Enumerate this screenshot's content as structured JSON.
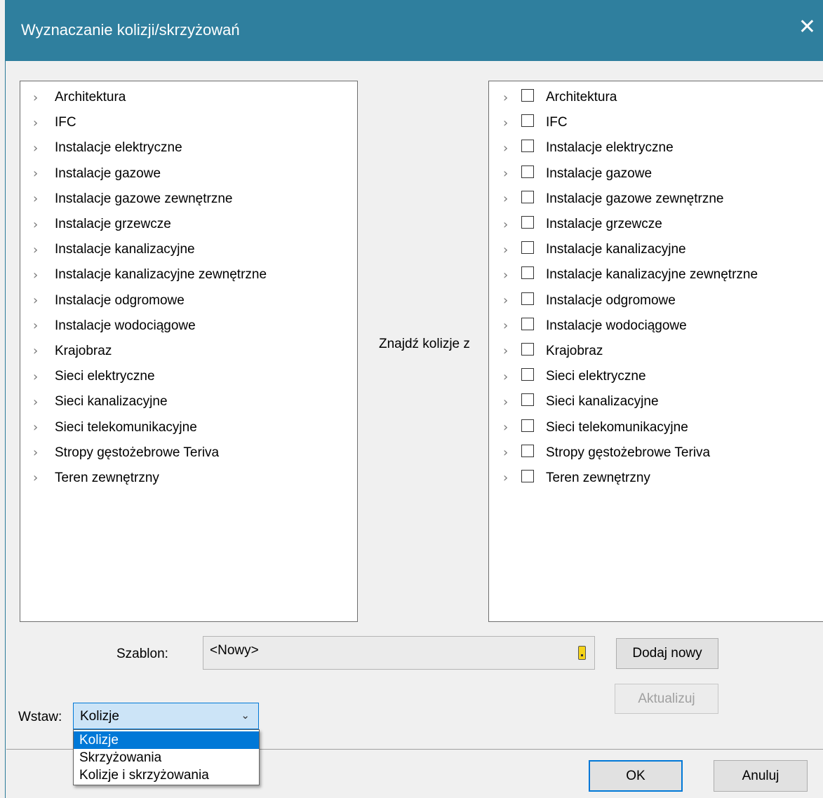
{
  "window": {
    "title": "Wyznaczanie kolizji/skrzyżowań",
    "close_glyph": "✕"
  },
  "left_tree": {
    "items": [
      "Architektura",
      "IFC",
      "Instalacje elektryczne",
      "Instalacje gazowe",
      "Instalacje gazowe zewnętrzne",
      "Instalacje grzewcze",
      "Instalacje kanalizacyjne",
      "Instalacje kanalizacyjne zewnętrzne",
      "Instalacje odgromowe",
      "Instalacje wodociągowe",
      "Krajobraz",
      "Sieci elektryczne",
      "Sieci kanalizacyjne",
      "Sieci telekomunikacyjne",
      "Stropy gęstożebrowe Teriva",
      "Teren zewnętrzny"
    ]
  },
  "middle_label": "Znajdź kolizje z",
  "right_tree": {
    "items": [
      "Architektura",
      "IFC",
      "Instalacje elektryczne",
      "Instalacje gazowe",
      "Instalacje gazowe zewnętrzne",
      "Instalacje grzewcze",
      "Instalacje kanalizacyjne",
      "Instalacje kanalizacyjne zewnętrzne",
      "Instalacje odgromowe",
      "Instalacje wodociągowe",
      "Krajobraz",
      "Sieci elektryczne",
      "Sieci kanalizacyjne",
      "Sieci telekomunikacyjne",
      "Stropy gęstożebrowe Teriva",
      "Teren zewnętrzny"
    ],
    "checked": [
      false,
      false,
      false,
      false,
      false,
      false,
      false,
      false,
      false,
      false,
      false,
      false,
      false,
      false,
      false,
      false
    ]
  },
  "template": {
    "label": "Szablon:",
    "value": "<Nowy>",
    "add_button": "Dodaj nowy",
    "update_button": "Aktualizuj"
  },
  "insert": {
    "label": "Wstaw:",
    "selected": "Kolizje",
    "options": [
      "Kolizje",
      "Skrzyżowania",
      "Kolizje i skrzyżowania"
    ]
  },
  "buttons": {
    "ok": "OK",
    "cancel": "Anuluj"
  },
  "colors": {
    "titlebar": "#2f7f9e",
    "accent": "#0078d7"
  }
}
